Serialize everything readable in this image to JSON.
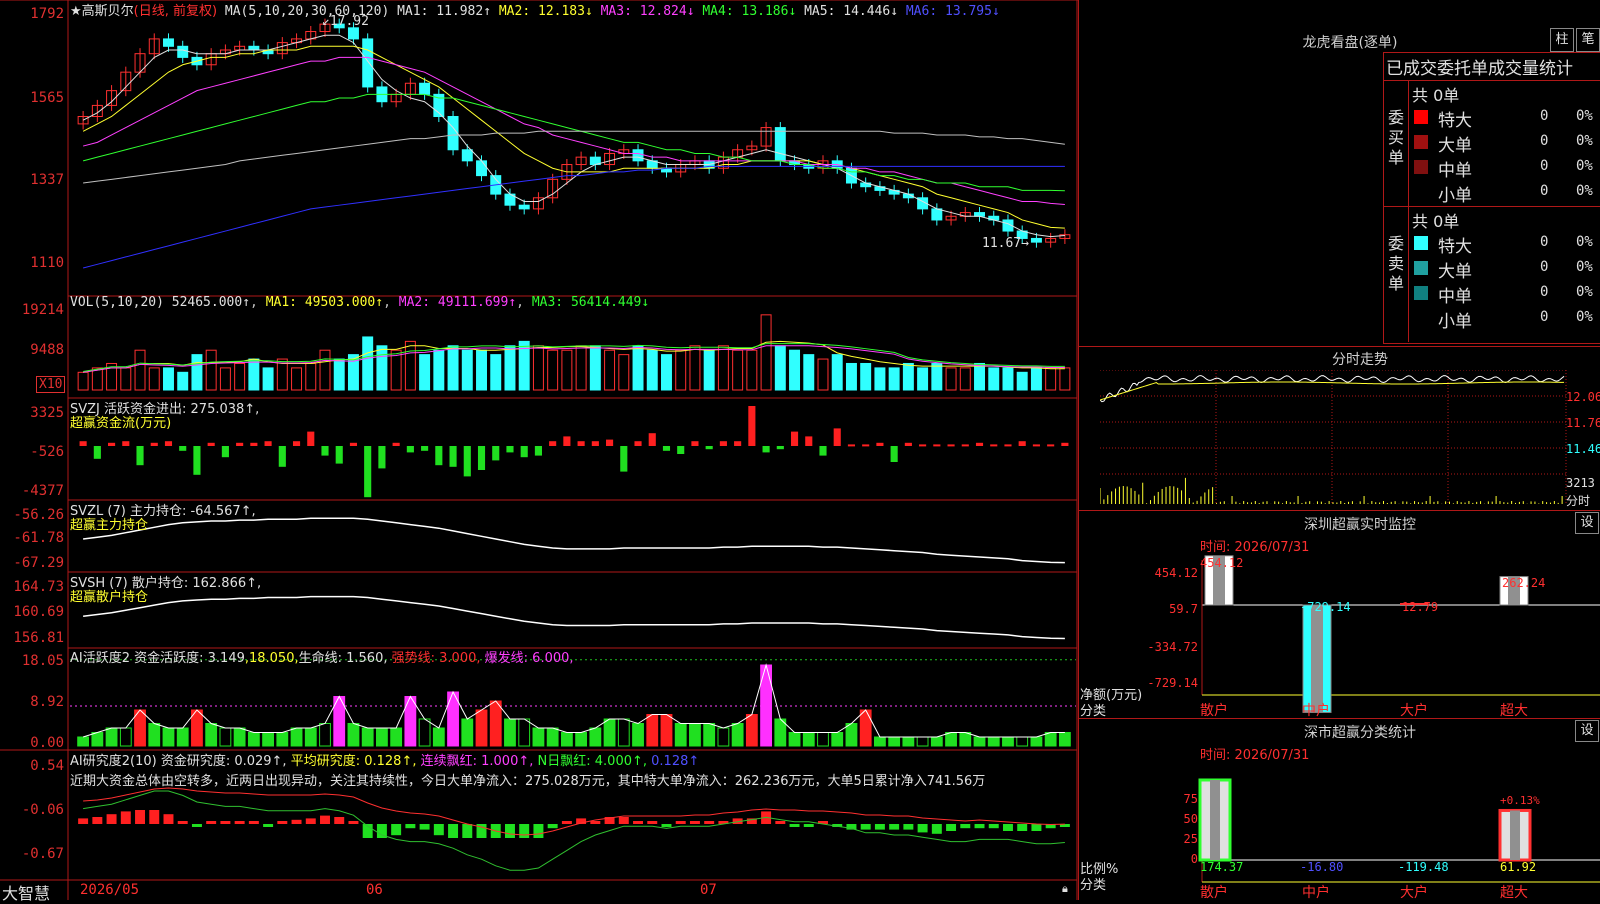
{
  "stock": {
    "name": "★高斯贝尔",
    "mode": "(日线, 前复权)",
    "ma_header": "MA(5,10,20,30,60,120)",
    "ma": [
      {
        "label": "MA1: 11.982↑",
        "color": "#e0e0e0"
      },
      {
        "label": "MA2: 12.183↓",
        "color": "#ffff30"
      },
      {
        "label": "MA3: 12.824↓",
        "color": "#ff40ff"
      },
      {
        "label": "MA4: 13.186↓",
        "color": "#30ff30"
      },
      {
        "label": "MA5: 14.446↓",
        "color": "#e0e0e0"
      },
      {
        "label": "MA6: 13.795↓",
        "color": "#5050ff"
      }
    ],
    "high_mark": "17.92",
    "low_mark": "11.67",
    "price_axis": [
      "1792",
      "1565",
      "1337",
      "1110"
    ]
  },
  "price_series": {
    "closes": [
      15.2,
      15.5,
      15.9,
      16.4,
      16.9,
      17.3,
      17.1,
      16.8,
      16.6,
      16.9,
      17.0,
      17.1,
      17.0,
      16.9,
      17.2,
      17.3,
      17.5,
      17.7,
      17.6,
      17.3,
      16.0,
      15.6,
      15.8,
      16.1,
      15.8,
      15.2,
      14.3,
      14.0,
      13.6,
      13.1,
      12.8,
      12.7,
      13.0,
      13.5,
      13.9,
      14.1,
      13.9,
      14.2,
      14.3,
      14.0,
      13.8,
      13.7,
      13.9,
      14.0,
      13.8,
      14.1,
      14.3,
      14.4,
      14.9,
      14.0,
      13.9,
      13.8,
      14.0,
      13.8,
      13.4,
      13.3,
      13.2,
      13.1,
      13.0,
      12.7,
      12.4,
      12.5,
      12.6,
      12.5,
      12.4,
      12.1,
      11.9,
      11.8,
      11.9,
      12.0
    ],
    "ma_short": [
      15.1,
      15.3,
      15.6,
      16.0,
      16.4,
      16.8,
      17.0,
      17.0,
      16.9,
      16.9,
      16.9,
      17.0,
      17.0,
      17.0,
      17.1,
      17.2,
      17.3,
      17.4,
      17.4,
      17.2,
      16.7,
      16.2,
      15.9,
      15.7,
      15.6,
      15.3,
      14.9,
      14.4,
      14.0,
      13.5,
      13.1,
      12.9,
      12.9,
      13.1,
      13.4,
      13.7,
      13.9,
      14.0,
      14.1,
      14.1,
      14.0,
      13.9,
      13.9,
      13.9,
      13.9,
      14.0,
      14.1,
      14.2,
      14.3,
      14.2,
      14.1,
      14.0,
      13.9,
      13.8,
      13.6,
      13.4,
      13.3,
      13.2,
      13.1,
      12.9,
      12.7,
      12.6,
      12.5,
      12.5,
      12.4,
      12.3,
      12.1,
      12.0,
      11.95,
      11.98
    ],
    "ma_mid": [
      14.8,
      15.0,
      15.2,
      15.5,
      15.8,
      16.1,
      16.4,
      16.6,
      16.7,
      16.8,
      16.8,
      16.9,
      16.9,
      17.0,
      17.0,
      17.0,
      17.1,
      17.1,
      17.1,
      17.1,
      17.0,
      16.8,
      16.6,
      16.4,
      16.2,
      16.0,
      15.7,
      15.4,
      15.1,
      14.8,
      14.5,
      14.2,
      14.0,
      13.8,
      13.7,
      13.7,
      13.7,
      13.7,
      13.8,
      13.8,
      13.8,
      13.8,
      13.8,
      13.8,
      13.8,
      13.9,
      13.9,
      14.0,
      14.0,
      14.0,
      14.0,
      14.0,
      13.9,
      13.9,
      13.8,
      13.7,
      13.6,
      13.5,
      13.4,
      13.3,
      13.1,
      13.0,
      12.9,
      12.8,
      12.7,
      12.6,
      12.4,
      12.3,
      12.2,
      12.18
    ],
    "ma_30": [
      14.4,
      14.5,
      14.7,
      14.9,
      15.1,
      15.3,
      15.5,
      15.7,
      15.9,
      16.0,
      16.1,
      16.2,
      16.3,
      16.4,
      16.5,
      16.6,
      16.7,
      16.7,
      16.8,
      16.8,
      16.8,
      16.7,
      16.6,
      16.5,
      16.4,
      16.2,
      16.0,
      15.8,
      15.6,
      15.4,
      15.2,
      15.0,
      14.9,
      14.7,
      14.6,
      14.5,
      14.4,
      14.3,
      14.2,
      14.2,
      14.1,
      14.1,
      14.0,
      14.0,
      14.0,
      14.0,
      14.0,
      14.0,
      14.0,
      14.0,
      14.0,
      13.9,
      13.9,
      13.9,
      13.8,
      13.8,
      13.7,
      13.7,
      13.6,
      13.5,
      13.4,
      13.4,
      13.3,
      13.2,
      13.1,
      13.0,
      12.9,
      12.9,
      12.85,
      12.82
    ],
    "ma_60": [
      14.0,
      14.1,
      14.2,
      14.3,
      14.4,
      14.5,
      14.6,
      14.7,
      14.8,
      14.9,
      15.0,
      15.1,
      15.2,
      15.3,
      15.4,
      15.5,
      15.6,
      15.6,
      15.7,
      15.7,
      15.8,
      15.8,
      15.8,
      15.8,
      15.8,
      15.7,
      15.7,
      15.6,
      15.5,
      15.4,
      15.3,
      15.2,
      15.1,
      15.0,
      14.9,
      14.8,
      14.7,
      14.6,
      14.5,
      14.5,
      14.4,
      14.3,
      14.3,
      14.2,
      14.2,
      14.1,
      14.1,
      14.0,
      14.0,
      14.0,
      13.9,
      13.9,
      13.8,
      13.8,
      13.7,
      13.7,
      13.6,
      13.6,
      13.5,
      13.5,
      13.4,
      13.4,
      13.4,
      13.3,
      13.3,
      13.3,
      13.2,
      13.2,
      13.2,
      13.19
    ],
    "ma_120": [
      13.4,
      13.45,
      13.5,
      13.55,
      13.6,
      13.65,
      13.7,
      13.75,
      13.8,
      13.85,
      13.9,
      14.0,
      14.05,
      14.1,
      14.15,
      14.2,
      14.25,
      14.3,
      14.35,
      14.4,
      14.45,
      14.5,
      14.55,
      14.6,
      14.6,
      14.65,
      14.7,
      14.7,
      14.7,
      14.75,
      14.75,
      14.75,
      14.8,
      14.8,
      14.8,
      14.8,
      14.8,
      14.8,
      14.8,
      14.8,
      14.8,
      14.8,
      14.8,
      14.8,
      14.8,
      14.8,
      14.8,
      14.8,
      14.8,
      14.8,
      14.8,
      14.8,
      14.8,
      14.8,
      14.8,
      14.8,
      14.8,
      14.75,
      14.75,
      14.75,
      14.7,
      14.7,
      14.7,
      14.65,
      14.65,
      14.6,
      14.6,
      14.55,
      14.5,
      14.45
    ],
    "ma_blue": [
      11.1,
      11.2,
      11.3,
      11.4,
      11.5,
      11.6,
      11.7,
      11.8,
      11.9,
      12.0,
      12.1,
      12.2,
      12.3,
      12.4,
      12.5,
      12.6,
      12.7,
      12.75,
      12.8,
      12.85,
      12.9,
      12.95,
      13.0,
      13.05,
      13.1,
      13.15,
      13.2,
      13.25,
      13.3,
      13.35,
      13.4,
      13.45,
      13.5,
      13.55,
      13.6,
      13.6,
      13.65,
      13.7,
      13.7,
      13.75,
      13.75,
      13.8,
      13.8,
      13.8,
      13.85,
      13.85,
      13.85,
      13.85,
      13.85,
      13.85,
      13.85,
      13.85,
      13.85,
      13.85,
      13.85,
      13.85,
      13.85,
      13.85,
      13.85,
      13.85,
      13.85,
      13.85,
      13.85,
      13.85,
      13.85,
      13.85,
      13.85,
      13.85,
      13.85,
      13.85
    ]
  },
  "vol": {
    "header": "VOL(5,10,20)",
    "value": "52465.000↑",
    "ma1": "MA1: 49503.000↑",
    "ma2": "MA2: 49111.699↑",
    "ma3": "MA3: 56414.449↓",
    "axis": [
      "19214",
      "9488"
    ],
    "multiplier": "X10",
    "bars": [
      4,
      5,
      6,
      5,
      9,
      5,
      5,
      4,
      8,
      9,
      5,
      6,
      7,
      5,
      7,
      5,
      6,
      9,
      7,
      8,
      12,
      10,
      9,
      11,
      8,
      9,
      10,
      9,
      9,
      8,
      10,
      11,
      10,
      9,
      9,
      10,
      10,
      9,
      8,
      10,
      9,
      8,
      9,
      10,
      9,
      10,
      9,
      9,
      17,
      10,
      9,
      8,
      7,
      8,
      6,
      6,
      5,
      5,
      6,
      5,
      6,
      5,
      5,
      6,
      5,
      5,
      4,
      5,
      5,
      5
    ]
  },
  "svzj": {
    "header": "SVZJ 活跃资金进出: 275.038↑,",
    "sub": "超赢资金流(万元)",
    "axis": [
      "3325",
      "-526",
      "-4377"
    ],
    "bars": [
      0.3,
      -0.8,
      0.2,
      0.3,
      -1.2,
      0.2,
      0.3,
      -0.3,
      -1.8,
      0.2,
      -0.7,
      0.2,
      0.2,
      0.3,
      -1.3,
      0.3,
      0.9,
      -0.6,
      -1.1,
      0.2,
      -3.2,
      -1.4,
      0.2,
      -0.4,
      -0.3,
      -1.2,
      -1.3,
      -1.9,
      -1.5,
      -0.9,
      -0.4,
      -0.7,
      -0.6,
      0.3,
      0.6,
      0.3,
      0.3,
      0.4,
      -1.6,
      0.3,
      0.8,
      -0.3,
      -0.5,
      0.3,
      -0.2,
      0.3,
      0.3,
      2.5,
      -0.4,
      -0.2,
      0.9,
      0.6,
      -0.6,
      1.1,
      0.1,
      0.1,
      0.2,
      -1.0,
      0.2,
      0.1,
      0.1,
      0.1,
      0.1,
      0.2,
      0.1,
      0.1,
      0.3,
      0.1,
      0.1,
      0.2
    ]
  },
  "svzl": {
    "header": "SVZL (7) 主力持仓: -64.567↑,",
    "sub": "超赢主力持仓",
    "axis": [
      "-56.26",
      "-61.78",
      "-67.29"
    ]
  },
  "svsh": {
    "header": "SVSH (7) 散户持仓: 162.866↑,",
    "sub": "超赢散户持仓",
    "axis": [
      "164.73",
      "160.69",
      "156.81"
    ]
  },
  "ai_active": {
    "header": "AI活跃度2 资金活跃度: 3.149",
    "v1": ",18.050,",
    "v2": "生命线: 1.560,",
    "v3": "强势线: 3.000,",
    "v4": "爆发线: 6.000,",
    "axis": [
      "18.05",
      "8.92",
      "0.00"
    ],
    "bars": [
      2,
      3,
      4,
      4,
      8,
      5,
      4,
      4,
      8,
      5,
      4,
      4,
      3,
      3,
      3,
      4,
      4,
      5,
      11,
      5,
      4,
      4,
      4,
      11,
      6,
      4,
      12,
      6,
      8,
      10,
      6,
      6,
      4,
      4,
      3,
      3,
      4,
      6,
      6,
      5,
      7,
      7,
      5,
      5,
      5,
      4,
      5,
      7,
      18,
      6,
      3,
      3,
      3,
      3,
      5,
      8,
      2,
      2,
      2,
      2,
      2,
      3,
      3,
      2,
      2,
      2,
      2,
      2,
      3,
      3
    ]
  },
  "ai_research": {
    "header": "AI研究度2(10) 资金研究度: 0.029↑,",
    "avg": "平均研究度: 0.128↑,",
    "red": "连续飘红: 1.000↑,",
    "nred": "N日飘红: 4.000↑,",
    "last": "0.128↑",
    "axis": [
      "0.54",
      "-0.06",
      "-0.67"
    ],
    "text": "近期大资金总体由空转多，近两日出现异动，关注其持续性，今日大单净流入：275.028万元，其中特大单净流入：262.236万元，大单5日累计净入741.56万"
  },
  "timeline": {
    "app": "大智慧",
    "d1": "2026/05",
    "d2": "06",
    "d3": "07"
  },
  "dragon": {
    "title": "龙虎看盘(逐单)",
    "btn1": "柱",
    "btn2": "笔",
    "header": "已成交委托单成交量统计",
    "buy_label": "委买单",
    "sell_label": "委卖单",
    "buy_total": "共 0单",
    "sell_total": "共 0单",
    "buy_rows": [
      {
        "label": "特大",
        "val": "0",
        "pct": "0%",
        "color": "#ff0000"
      },
      {
        "label": "大单",
        "val": "0",
        "pct": "0%",
        "color": "#a01010"
      },
      {
        "label": "中单",
        "val": "0",
        "pct": "0%",
        "color": "#801010"
      },
      {
        "label": "小单",
        "val": "0",
        "pct": "0%",
        "color": "#000000"
      }
    ],
    "sell_rows": [
      {
        "label": "特大",
        "val": "0",
        "pct": "0%",
        "color": "#30ffff"
      },
      {
        "label": "大单",
        "val": "0",
        "pct": "0%",
        "color": "#20a0a0"
      },
      {
        "label": "中单",
        "val": "0",
        "pct": "0%",
        "color": "#108080"
      },
      {
        "label": "小单",
        "val": "0",
        "pct": "0%",
        "color": "#000000"
      }
    ]
  },
  "intraday": {
    "title": "分时走势",
    "axis": [
      "12.06",
      "11.76",
      "11.46"
    ],
    "vol_label": "3213",
    "vol_unit": "分时"
  },
  "sz_monitor": {
    "title": "深圳超赢实时监控",
    "btn": "设",
    "time": "时间: 2026/07/31",
    "axis": [
      "454.12",
      "59.7",
      "-334.72",
      "-729.14"
    ],
    "unit": "净额(万元)",
    "cat_label": "分类",
    "cats": [
      "散户",
      "中户",
      "大户",
      "超大"
    ],
    "values": [
      454.12,
      -729.14,
      12.79,
      262.24
    ],
    "value_labels": [
      "454.12",
      "-729.14",
      "12.79",
      "262.24"
    ]
  },
  "sz_classify": {
    "title": "深市超赢分类统计",
    "btn": "设",
    "time": "时间: 2026/07/31",
    "axis": [
      "75",
      "50",
      "25",
      "0"
    ],
    "unit": "比例%",
    "cat_label": "分类",
    "cats": [
      "散户",
      "中户",
      "大户",
      "超大"
    ],
    "values": [
      174.37,
      -16.8,
      -119.48,
      61.92
    ],
    "value_labels": [
      "174.37",
      "-16.80",
      "-119.48",
      "61.92"
    ],
    "note": "+0.13%"
  }
}
